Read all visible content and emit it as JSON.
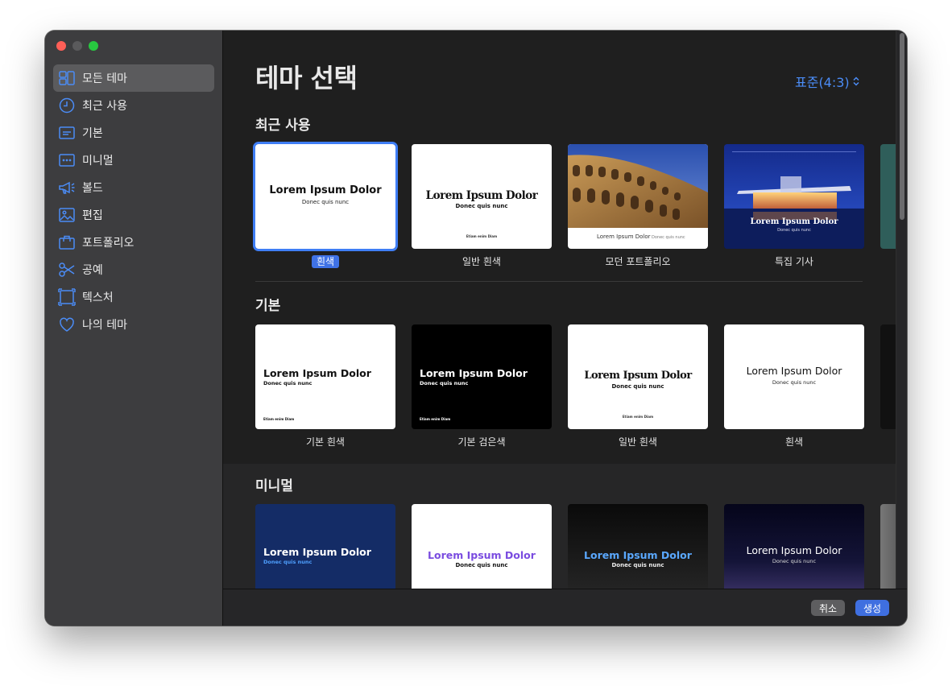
{
  "window": {
    "title": "테마 선택",
    "ratio_label": "표준(4:3)"
  },
  "sidebar": {
    "items": [
      {
        "label": "모든 테마",
        "icon": "all-themes-icon",
        "active": true
      },
      {
        "label": "최근 사용",
        "icon": "clock-icon"
      },
      {
        "label": "기본",
        "icon": "basic-icon"
      },
      {
        "label": "미니멀",
        "icon": "minimal-icon"
      },
      {
        "label": "볼드",
        "icon": "megaphone-icon"
      },
      {
        "label": "편집",
        "icon": "photo-icon"
      },
      {
        "label": "포트폴리오",
        "icon": "briefcase-icon"
      },
      {
        "label": "공예",
        "icon": "scissors-icon"
      },
      {
        "label": "텍스처",
        "icon": "texture-icon"
      },
      {
        "label": "나의 테마",
        "icon": "heart-icon"
      }
    ]
  },
  "sections": {
    "recent": {
      "title": "최근 사용",
      "items": [
        {
          "caption": "흰색",
          "main": "Lorem Ipsum Dolor",
          "sub": "Donec quis nunc",
          "selected": true
        },
        {
          "caption": "일반 흰색",
          "main": "Lorem Ipsum Dolor",
          "sub": "Donec quis nunc",
          "foot": "Etiam enim Diam"
        },
        {
          "caption": "모던 포트폴리오",
          "main": "Lorem Ipsum Dolor",
          "sub": "Donec quis nunc"
        },
        {
          "caption": "특집 기사",
          "main": "Lorem Ipsum Dolor",
          "sub": "Donec quis nunc"
        }
      ]
    },
    "basic": {
      "title": "기본",
      "items": [
        {
          "caption": "기본 흰색",
          "main": "Lorem Ipsum Dolor",
          "sub": "Donec quis nunc",
          "foot": "Etiam enim Diam"
        },
        {
          "caption": "기본 검은색",
          "main": "Lorem Ipsum Dolor",
          "sub": "Donec quis nunc",
          "foot": "Etiam enim Diam"
        },
        {
          "caption": "일반 흰색",
          "main": "Lorem Ipsum Dolor",
          "sub": "Donec quis nunc",
          "foot": "Etiam enim Diam"
        },
        {
          "caption": "흰색",
          "main": "Lorem Ipsum Dolor",
          "sub": "Donec quis nunc"
        }
      ]
    },
    "minimal": {
      "title": "미니멀",
      "items": [
        {
          "main": "Lorem Ipsum Dolor",
          "sub": "Donec quis nunc"
        },
        {
          "main": "Lorem Ipsum Dolor",
          "sub": "Donec quis nunc"
        },
        {
          "main": "Lorem Ipsum Dolor",
          "sub": "Donec quis nunc"
        },
        {
          "main": "Lorem Ipsum Dolor",
          "sub": "Donec quis nunc"
        }
      ]
    }
  },
  "footer": {
    "cancel_label": "취소",
    "create_label": "생성"
  },
  "colors": {
    "accent": "#3f7ef5",
    "sidebar": "#3d3d3f",
    "background": "#1f1f1f"
  }
}
